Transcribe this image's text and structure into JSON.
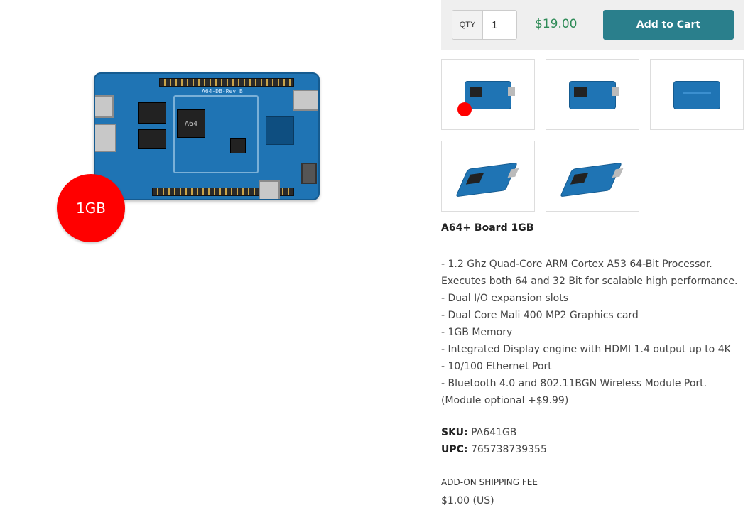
{
  "product": {
    "badge_text": "1GB",
    "title": "A64+ Board 1GB",
    "features": [
      "- 1.2 Ghz Quad-Core ARM Cortex A53 64-Bit Processor. Executes both 64 and 32 Bit for scalable high performance.",
      "- Dual I/O expansion slots",
      "- Dual Core Mali 400 MP2 Graphics card",
      "- 1GB Memory",
      "- Integrated Display engine with HDMI 1.4 output up to 4K",
      "- 10/100 Ethernet Port",
      "- Bluetooth 4.0 and 802.11BGN Wireless Module Port. (Module optional +$9.99)"
    ],
    "sku_label": "SKU:",
    "sku": "PA641GB",
    "upc_label": "UPC:",
    "upc": "765738739355"
  },
  "purchase": {
    "qty_label": "QTY",
    "qty_value": "1",
    "price": "$19.00",
    "add_to_cart_label": "Add to Cart",
    "price_color": "#2e8b57",
    "button_color": "#2a7f8c"
  },
  "board_silkscreen": {
    "chip_text": "A64",
    "model_text": "A64-DB-Rev B"
  },
  "thumbnails": [
    {
      "icon": "board-top-with-badge-thumbnail"
    },
    {
      "icon": "board-top-thumbnail"
    },
    {
      "icon": "board-bottom-thumbnail"
    },
    {
      "icon": "board-angled-thumbnail"
    },
    {
      "icon": "board-angled-ports-thumbnail"
    }
  ],
  "shipping": {
    "label": "ADD-ON SHIPPING FEE",
    "value": "$1.00 (US)"
  }
}
